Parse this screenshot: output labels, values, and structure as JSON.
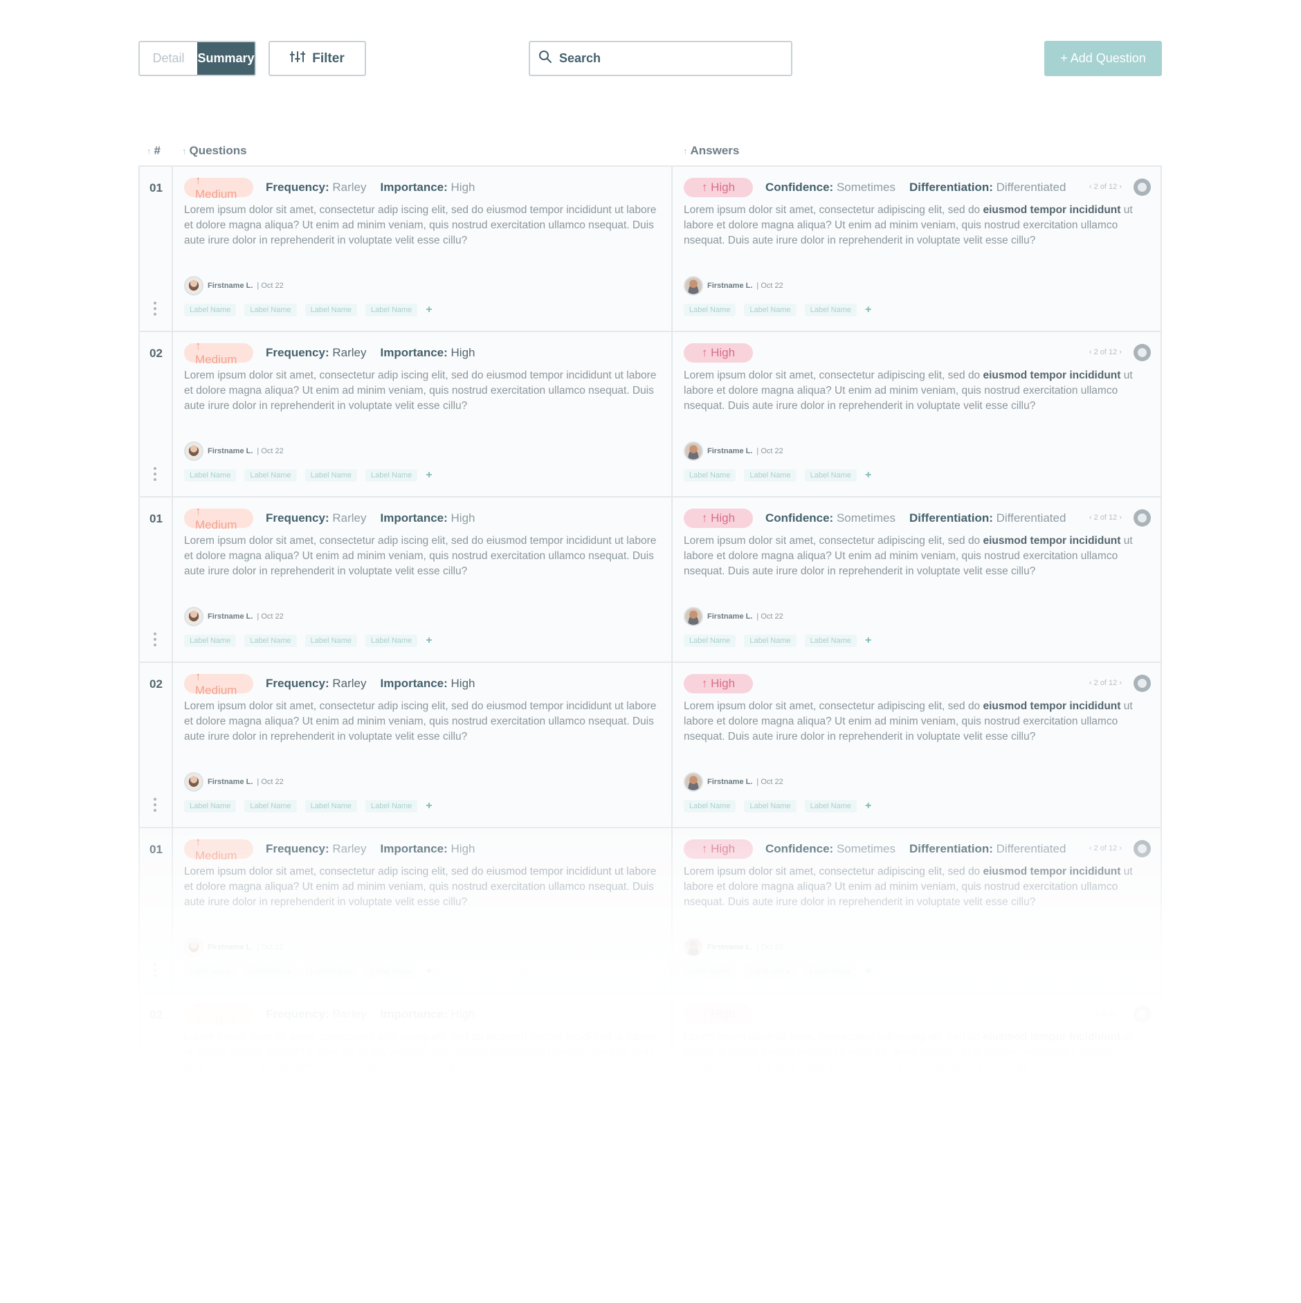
{
  "toolbar": {
    "view_detail": "Detail",
    "view_summary": "Summary",
    "filter_label": "Filter",
    "search_placeholder": "Search",
    "add_label": "+ Add Question"
  },
  "columns": {
    "num": "#",
    "questions": "Questions",
    "answers": "Answers"
  },
  "meta_labels": {
    "frequency": "Frequency:",
    "importance": "Importance:",
    "confidence": "Confidence:",
    "differentiation": "Differentiation:"
  },
  "question_text": "Lorem ipsum dolor sit amet, consectetur adip iscing elit, sed do eiusmod tempor incididunt ut labore et dolore magna aliqua? Ut enim ad minim veniam, quis nostrud exercitation ullamco nsequat. Duis aute irure dolor in reprehenderit in voluptate velit esse cillu?",
  "answer_text": {
    "before": "Lorem ipsum dolor sit amet, consectetur adipiscing elit, sed do ",
    "bold": "eiusmod tempor incididunt",
    "after": " ut labore et dolore magna aliqua? Ut enim ad minim veniam, quis nostrud exercitation ullamco nsequat. Duis aute irure dolor in reprehenderit in voluptate velit esse cillu?"
  },
  "author": {
    "name": "Firstname L.",
    "date": "| Oct 22"
  },
  "question_labels": [
    "Label Name",
    "Label Name",
    "Label Name",
    "Label Name"
  ],
  "answer_labels": [
    "Label Name",
    "Label Name",
    "Label Name"
  ],
  "rows": [
    {
      "num": "01",
      "q_badge": "↑ Medium",
      "frequency": "Rarley",
      "importance": "High",
      "a_badge": "↑ High",
      "confidence": "Sometimes",
      "differentiation": "Differentiated",
      "pager": "‹ 2 of 12 ›"
    },
    {
      "num": "02",
      "q_badge": "↑ Medium",
      "frequency": "Rarley",
      "importance": "High",
      "a_badge": "↑ High",
      "pager": "‹ 2 of 12 ›"
    },
    {
      "num": "01",
      "q_badge": "↑ Medium",
      "frequency": "Rarley",
      "importance": "High",
      "a_badge": "↑ High",
      "confidence": "Sometimes",
      "differentiation": "Differentiated",
      "pager": "‹ 2 of 12 ›"
    },
    {
      "num": "02",
      "q_badge": "↑ Medium",
      "frequency": "Rarley",
      "importance": "High",
      "a_badge": "↑ High",
      "pager": "‹ 2 of 12 ›"
    },
    {
      "num": "01",
      "q_badge": "↑ Medium",
      "frequency": "Rarley",
      "importance": "High",
      "a_badge": "↑ High",
      "confidence": "Sometimes",
      "differentiation": "Differentiated",
      "pager": "‹ 2 of 12 ›"
    },
    {
      "num": "02",
      "q_badge": "↑ Medium",
      "frequency": "Rarley",
      "importance": "High",
      "a_badge": "↑ High",
      "pager": "‹ 2 of 12 ›"
    }
  ]
}
